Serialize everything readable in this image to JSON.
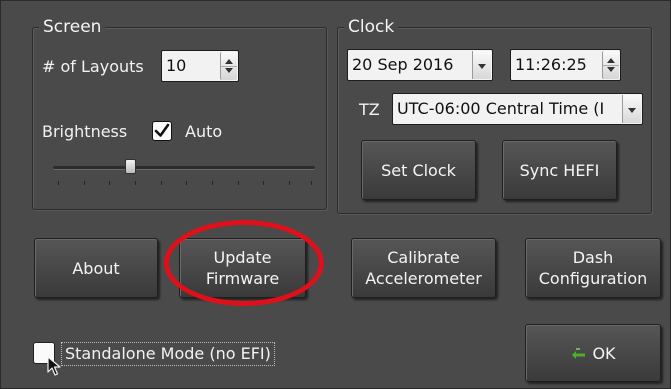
{
  "screen": {
    "title": "Screen",
    "layouts_label": "# of Layouts",
    "layouts_value": "10",
    "brightness_label": "Brightness",
    "auto_checked": true,
    "auto_label": "Auto",
    "brightness_level_fraction": 0.32
  },
  "clock": {
    "title": "Clock",
    "date_value": "20 Sep 2016",
    "time_value": "11:26:25",
    "tz_label": "TZ",
    "tz_value": "UTC-06:00 Central Time (I",
    "set_clock_label": "Set Clock",
    "sync_hefi_label": "Sync HEFI"
  },
  "buttons": {
    "about_label": "About",
    "update_firmware_line1": "Update",
    "update_firmware_line2": "Firmware",
    "calibrate_line1": "Calibrate",
    "calibrate_line2": "Accelerometer",
    "dash_line1": "Dash",
    "dash_line2": "Configuration",
    "ok_label": "OK"
  },
  "standalone": {
    "label": "Standalone Mode (no EFI)",
    "checked": false
  },
  "icons": {
    "ok": "green-check-arrow-icon",
    "spin": "up-down-spinner-icon",
    "dropdown": "chevron-down-icon",
    "cursor": "mouse-pointer-icon"
  },
  "colors": {
    "highlight_ring": "#e0101a",
    "panel_background": "#4a4a4a",
    "ok_icon": "#4caf2a"
  }
}
